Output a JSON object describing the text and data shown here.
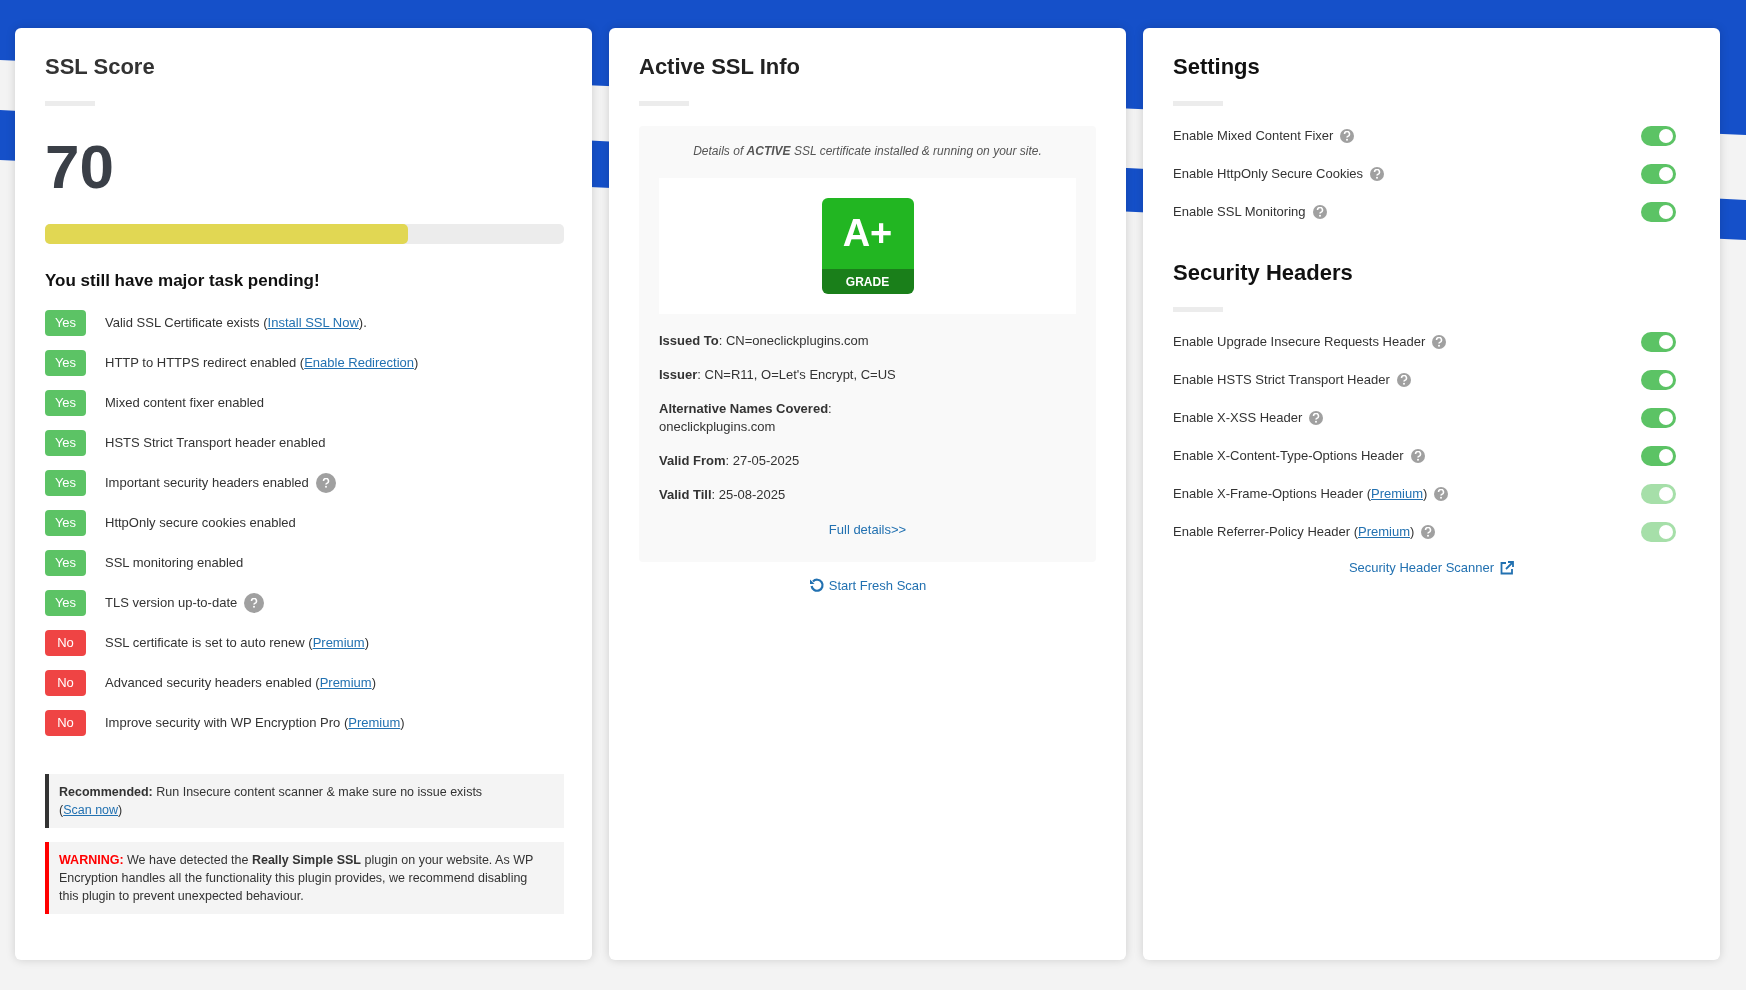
{
  "score_card": {
    "title": "SSL Score",
    "score": "70",
    "level": 0.7,
    "heading": "You still have major task pending!",
    "checks": [
      {
        "status": "Yes",
        "passed": true,
        "text": "Valid SSL Certificate exists (",
        "link": "Install SSL Now",
        "after": ").",
        "help": false
      },
      {
        "status": "Yes",
        "passed": true,
        "text": "HTTP to HTTPS redirect enabled (",
        "link": "Enable Redirection",
        "after": ")",
        "help": false
      },
      {
        "status": "Yes",
        "passed": true,
        "text": "Mixed content fixer enabled",
        "help": false
      },
      {
        "status": "Yes",
        "passed": true,
        "text": "HSTS Strict Transport header enabled",
        "help": false
      },
      {
        "status": "Yes",
        "passed": true,
        "text": "Important security headers enabled",
        "help": true
      },
      {
        "status": "Yes",
        "passed": true,
        "text": "HttpOnly secure cookies enabled",
        "help": false
      },
      {
        "status": "Yes",
        "passed": true,
        "text": "SSL monitoring enabled",
        "help": false
      },
      {
        "status": "Yes",
        "passed": true,
        "text": "TLS version up-to-date",
        "help": true
      },
      {
        "status": "No",
        "passed": false,
        "text": "SSL certificate is set to auto renew (",
        "link": "Premium",
        "after": ")",
        "help": false
      },
      {
        "status": "No",
        "passed": false,
        "text": "Advanced security headers enabled (",
        "link": "Premium",
        "after": ")",
        "help": false
      },
      {
        "status": "No",
        "passed": false,
        "text": "Improve security with WP Encryption Pro (",
        "link": "Premium",
        "after": ")",
        "help": false
      }
    ],
    "notices": [
      {
        "kind": "recommended",
        "label": "Recommended:",
        "text": " Run Insecure content scanner & make sure no issue exists (",
        "link": "Scan now",
        "after": ")"
      },
      {
        "kind": "warning",
        "label": "WARNING:",
        "text": " We have detected the **Really Simple SSL** plugin on your website. As WP Encryption handles all the functionality this plugin provides, we recommend disabling this plugin to prevent unexpected behaviour."
      }
    ]
  },
  "ssl_card": {
    "title": "Active SSL Info",
    "intro": "Details of **ACTIVE** SSL certificate installed & running on your site.",
    "grade": "A+",
    "grade_label": "GRADE",
    "fields": [
      {
        "label": "Issued To",
        "sep": ":",
        "value": "CN=oneclickplugins.com",
        "kind": "inline"
      },
      {
        "label": "Issuer",
        "sep": ":",
        "value": "CN=R11, O=Let's Encrypt, C=US",
        "kind": "inline"
      },
      {
        "label": "Alternative Names Covered",
        "sep": ":",
        "value": "oneclickplugins.com",
        "kind": "stacked"
      },
      {
        "label": "Valid From",
        "sep": ":",
        "value": "27-05-2025",
        "kind": "inline"
      },
      {
        "label": "Valid Till",
        "sep": ":",
        "value": "25-08-2025",
        "kind": "inline"
      }
    ],
    "details_link": "Full details>>",
    "scan_button": "Start Fresh Scan"
  },
  "settings_card": {
    "sections": [
      {
        "title": "Settings",
        "toggles": [
          {
            "label": "Enable Mixed Content Fixer",
            "on": true,
            "disabled": false
          },
          {
            "label": "Enable HttpOnly Secure Cookies",
            "on": true,
            "disabled": false
          },
          {
            "label": "Enable SSL Monitoring",
            "on": true,
            "disabled": false
          }
        ]
      },
      {
        "title": "Security Headers",
        "toggles": [
          {
            "label": "Enable Upgrade Insecure Requests Header",
            "on": true,
            "disabled": false
          },
          {
            "label": "Enable HSTS Strict Transport Header",
            "on": true,
            "disabled": false
          },
          {
            "label": "Enable X-XSS Header",
            "on": true,
            "disabled": false
          },
          {
            "label": "Enable X-Content-Type-Options Header",
            "on": true,
            "disabled": false
          },
          {
            "label": "Enable X-Frame-Options Header (",
            "link": "Premium",
            "after": ")",
            "on": true,
            "disabled": true
          },
          {
            "label": "Enable Referrer-Policy Header (",
            "link": "Premium",
            "after": ")",
            "on": true,
            "disabled": true
          }
        ]
      }
    ],
    "scanner_link": "Security Header Scanner"
  }
}
